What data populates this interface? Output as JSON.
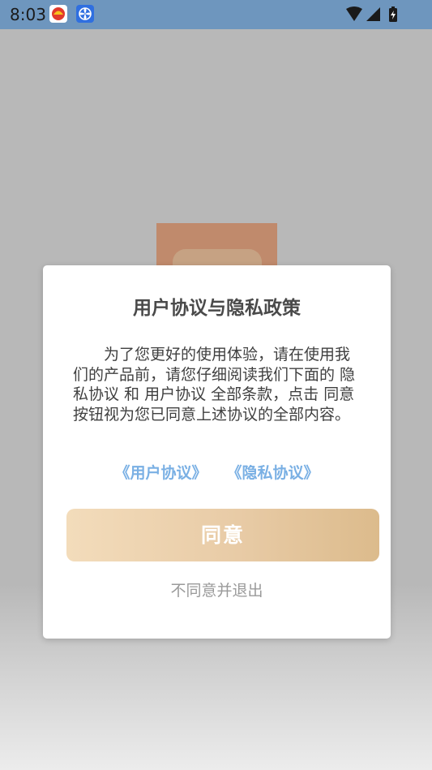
{
  "status_bar": {
    "time": "8:03",
    "notification_icons": [
      "petrochina-app-icon",
      "fan-app-icon"
    ],
    "indicators": [
      "wifi-icon",
      "cell-signal-icon",
      "battery-charging-icon"
    ]
  },
  "dialog": {
    "title": "用户协议与隐私政策",
    "body": {
      "intro": "为了您更好的使用体验，请在使用我们的产品前，请您仔细阅读我们下面的 ",
      "privacy_mention": "隐私协议",
      "conjunction": " 和 ",
      "user_mention": "用户协议",
      "middle": " 全部条款，点击 ",
      "agree_mention": "同意",
      "ending": " 按钮视为您已同意上述协议的全部内容。"
    },
    "links": {
      "user_agreement": "《用户协议》",
      "privacy_agreement": "《隐私协议》"
    },
    "agree_button": "同意",
    "decline_button": "不同意并退出"
  },
  "colors": {
    "status_bar": "#6e96be",
    "link": "#7ab0e4",
    "agree_gradient_start": "#f3dcbb",
    "agree_gradient_end": "#dcbb8c",
    "overlay": "#b8b8b8"
  }
}
